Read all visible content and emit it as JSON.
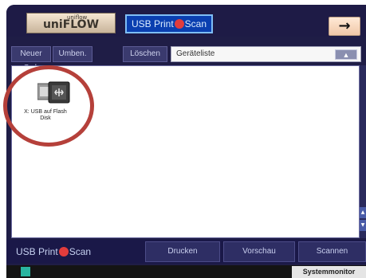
{
  "topbar": {
    "uniflow_label": "uniFLOW",
    "uniflow_small": "uniflow",
    "usb_tab_label_left": "USB Print",
    "usb_tab_label_right": "Scan",
    "arrow": "→"
  },
  "toolbar": {
    "new_folder": "Neuer Ord.",
    "rename": "Umben.",
    "delete": "Löschen",
    "path": "Geräteliste",
    "up": "▲"
  },
  "files": [
    {
      "label": "X: USB auf Flash Disk",
      "icon": "usb-drive-icon"
    }
  ],
  "bottombar": {
    "brand_left": "USB Print",
    "brand_right": "Scan",
    "print": "Drucken",
    "preview": "Vorschau",
    "scan": "Scannen"
  },
  "statusbar": {
    "system_monitor": "Systemmonitor"
  },
  "colors": {
    "background": "#1f1d46",
    "highlight": "#b5403a",
    "accent": "#0a3fb0"
  }
}
